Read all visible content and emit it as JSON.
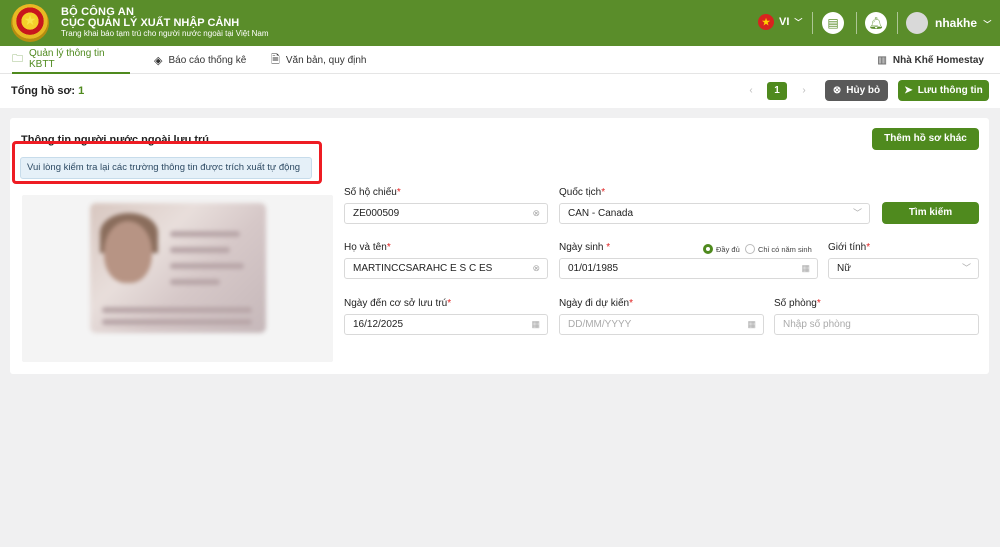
{
  "header": {
    "org_line1": "BỘ CÔNG AN",
    "org_line2": "CỤC QUẢN LÝ XUẤT NHẬP CẢNH",
    "subtitle": "Trang khai báo tạm trú cho người nước ngoài tại Việt Nam",
    "language": "VI",
    "username": "nhakhe"
  },
  "nav": {
    "tabs": [
      {
        "label": "Quản lý thông tin KBTT",
        "icon": "folder-icon",
        "active": true
      },
      {
        "label": "Báo cáo thống kê",
        "icon": "layers-icon",
        "active": false
      },
      {
        "label": "Văn bản, quy định",
        "icon": "document-icon",
        "active": false
      }
    ],
    "homestay": "Nhà Khế Homestay"
  },
  "toolbar": {
    "total_label": "Tổng hồ sơ:",
    "total_value": "1",
    "page": "1",
    "cancel_label": "Hủy bỏ",
    "save_label": "Lưu thông tin"
  },
  "form": {
    "title": "Thông tin người nước ngoài lưu trú",
    "add_profile_label": "Thêm hồ sơ khác",
    "notice": "Vui lòng kiểm tra lại các trường thông tin được trích xuất tự động",
    "search_label": "Tìm kiếm",
    "passport": {
      "label": "Số hộ chiếu",
      "value": "ZE000509"
    },
    "nationality": {
      "label": "Quốc tịch",
      "value": "CAN - Canada"
    },
    "fullname": {
      "label": "Họ và tên",
      "value": "MARTINCCSARAHC E S C ES"
    },
    "birthdate": {
      "label": "Ngày sinh",
      "value": "01/01/1985",
      "option_full": "Đầy đủ",
      "option_year": "Chỉ có năm sinh"
    },
    "gender": {
      "label": "Giới tính",
      "value": "Nữ"
    },
    "arrival": {
      "label": "Ngày đến cơ sở lưu trú",
      "value": "16/12/2025"
    },
    "departure": {
      "label": "Ngày đi dự kiến",
      "placeholder": "DD/MM/YYYY"
    },
    "room": {
      "label": "Số phòng",
      "placeholder": "Nhập số phòng"
    }
  },
  "colors": {
    "brand_green": "#5a8d2a",
    "accent_green": "#4f8a1e",
    "highlight_red": "#ee1c23"
  }
}
